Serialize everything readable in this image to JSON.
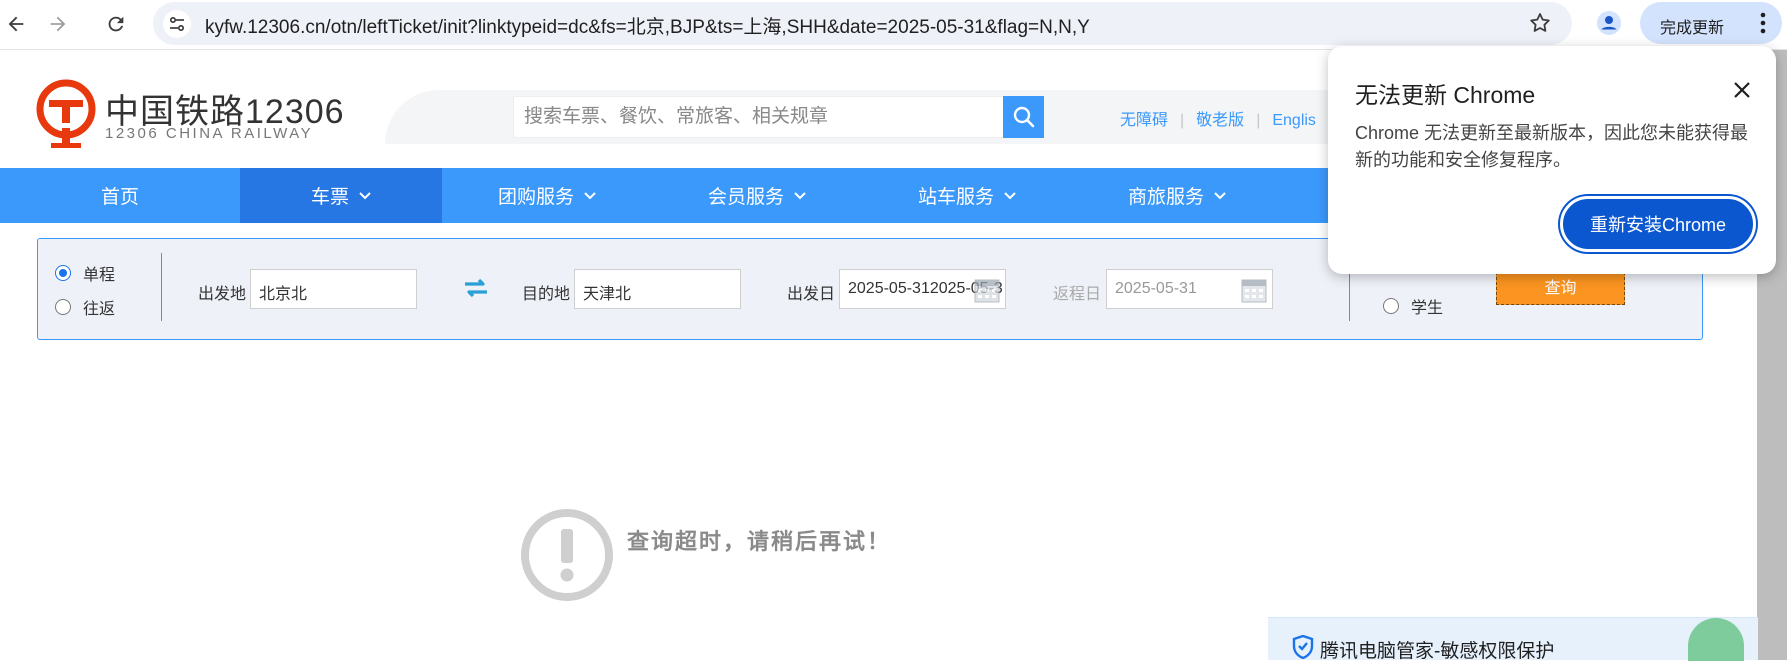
{
  "browser": {
    "url": "kyfw.12306.cn/otn/leftTicket/init?linktypeid=dc&fs=北京,BJP&ts=上海,SHH&date=2025-05-31&flag=N,N,Y",
    "update_label": "完成更新"
  },
  "site": {
    "brand_cn": "中国铁路12306",
    "brand_en": "12306 CHINA RAILWAY",
    "search_placeholder": "搜索车票、餐饮、常旅客、相关规章",
    "links": [
      "无障碍",
      "敬老版",
      "Englis"
    ]
  },
  "nav": {
    "items": [
      {
        "label": "首页",
        "dropdown": false
      },
      {
        "label": "车票",
        "dropdown": true,
        "active": true
      },
      {
        "label": "团购服务",
        "dropdown": true
      },
      {
        "label": "会员服务",
        "dropdown": true
      },
      {
        "label": "站车服务",
        "dropdown": true
      },
      {
        "label": "商旅服务",
        "dropdown": true
      }
    ]
  },
  "query": {
    "trip_single": "单程",
    "trip_round": "往返",
    "from_label": "出发地",
    "from_value": "北京北",
    "to_label": "目的地",
    "to_value": "天津北",
    "date_label": "出发日",
    "date_value": "2025-05-312025-05-3",
    "return_label": "返程日",
    "return_value": "2025-05-31",
    "student_label": "学生",
    "query_button": "查询"
  },
  "message": {
    "timeout": "查询超时，请稍后再试！"
  },
  "popup": {
    "title": "无法更新 Chrome",
    "body": "Chrome 无法更新至最新版本，因此您未能获得最新的功能和安全修复程序。",
    "button": "重新安装Chrome"
  },
  "tencent": {
    "label": "腾讯电脑管家-敏感权限保护"
  },
  "colors": {
    "nav_blue": "#3b99fc",
    "nav_active": "#2676e3",
    "query_orange": "#fb9420",
    "chrome_blue": "#0b57d0",
    "logo_red": "#e8380d"
  }
}
